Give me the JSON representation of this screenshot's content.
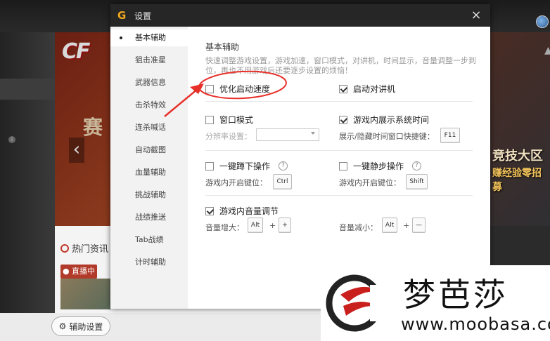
{
  "dialog": {
    "title": "设置",
    "app_logo_glyph": "G",
    "close_glyph": "×"
  },
  "sidebar": {
    "items": [
      {
        "label": "基本辅助",
        "active": true
      },
      {
        "label": "狙击准星"
      },
      {
        "label": "武器信息"
      },
      {
        "label": "击杀特效"
      },
      {
        "label": "连杀喊话"
      },
      {
        "label": "自动截图"
      },
      {
        "label": "血量辅助"
      },
      {
        "label": "挑战辅助"
      },
      {
        "label": "战绩推送"
      },
      {
        "label": "Tab战绩"
      },
      {
        "label": "计时辅助"
      }
    ]
  },
  "content": {
    "section_title": "基本辅助",
    "description": "快速调整游戏设置，游戏加速，窗口模式，对讲机，时间显示，音量调整一步到位，再也不用游戏后还要逐步设置的烦恼！",
    "options": {
      "optimize_startup": {
        "label": "优化启动速度",
        "checked": false
      },
      "walkie_talkie": {
        "label": "启动对讲机",
        "checked": true
      },
      "window_mode": {
        "label": "窗口模式",
        "checked": false
      },
      "resolution_label": "分辨率设置：",
      "resolution_value": "",
      "show_system_time": {
        "label": "游戏内展示系统时间",
        "checked": true
      },
      "time_hotkey_label": "展示/隐藏时间窗口快捷键：",
      "time_hotkey": "F11",
      "one_key_squat": {
        "label": "一键蹲下操作",
        "checked": false
      },
      "squat_key_label": "游戏内开启键位：",
      "squat_key": "Ctrl",
      "one_key_mute": {
        "label": "一键静步操作",
        "checked": false
      },
      "mute_key_label": "游戏内开启键位：",
      "mute_key": "Shift",
      "volume_adjust": {
        "label": "游戏内音量调节",
        "checked": true
      },
      "vol_up_label": "音量增大：",
      "vol_up_key1": "Alt",
      "vol_up_key2": "+",
      "vol_down_label": "音量减小：",
      "vol_down_key1": "Alt",
      "vol_down_key2": "—",
      "plus_sign": "+",
      "help_glyph": "?"
    }
  },
  "background": {
    "news_title": "热门资讯",
    "live_badge": "● 直播中",
    "assist_button": "辅助设置",
    "banner_text": "赛",
    "right_title1": "竞技大区",
    "right_title2": "赚经验零招募",
    "left_arrow": "‹"
  },
  "watermark": {
    "chinese": "梦芭莎",
    "url": "www.moobasa.com"
  },
  "colors": {
    "titlebar": "#262626",
    "accent_logo": "#f0a81e",
    "annotation_red": "#e8302a"
  }
}
